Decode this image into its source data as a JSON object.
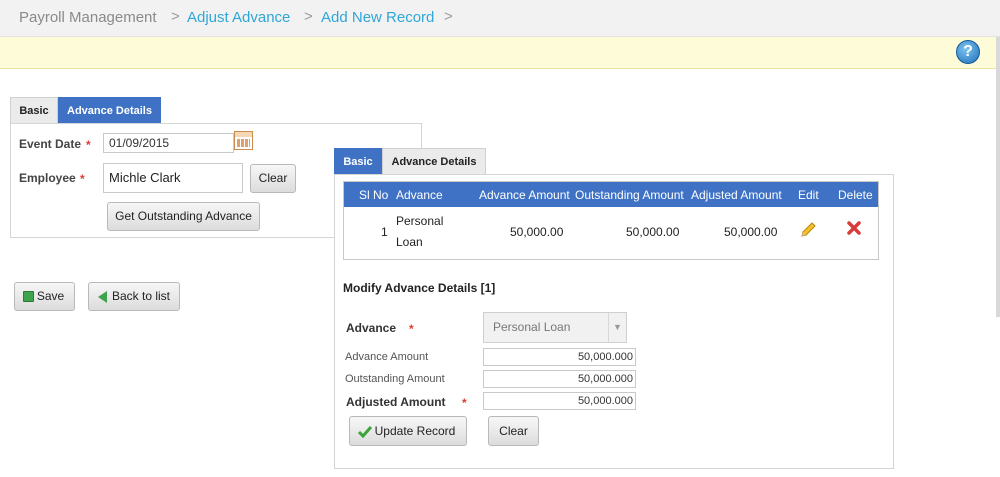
{
  "breadcrumb": {
    "home": "Payroll Management",
    "level1": "Adjust Advance",
    "level2": "Add New Record",
    "separator": ">"
  },
  "help_icon": "?",
  "form1": {
    "tabs": [
      "Basic",
      "Advance Details"
    ],
    "event_date_label": "Event Date",
    "event_date_value": "01/09/2015",
    "employee_label": "Employee",
    "employee_value": "Michle Clark",
    "clear_label": "Clear",
    "get_outstanding_label": "Get Outstanding Advance",
    "required_mark": "*"
  },
  "actions": {
    "save_label": "Save",
    "back_label": "Back to list"
  },
  "details": {
    "tabs": [
      "Basic",
      "Advance Details"
    ],
    "columns": [
      "Sl No",
      "Advance",
      "Advance Amount",
      "Outstanding Amount",
      "Adjusted Amount",
      "Edit",
      "Delete"
    ],
    "row": {
      "sl_no": "1",
      "advance_line1": "Personal",
      "advance_line2": "Loan",
      "advance_amount": "50,000.00",
      "outstanding_amount": "50,000.00",
      "adjusted_amount": "50,000.00"
    },
    "modify_title": "Modify Advance Details [1]",
    "advance_label": "Advance",
    "advance_selected": "Personal Loan",
    "advance_amount_label": "Advance Amount",
    "advance_amount_value": "50,000.000",
    "outstanding_amount_label": "Outstanding Amount",
    "outstanding_amount_value": "50,000.000",
    "adjusted_amount_label": "Adjusted Amount",
    "adjusted_amount_value": "50,000.000",
    "update_label": "Update Record",
    "clear_label": "Clear"
  },
  "colors": {
    "tab_active": "#3f72c4",
    "breadcrumb_link": "#2fa6d8",
    "required": "#e03c31",
    "notice_bg": "#fdfbd8"
  }
}
